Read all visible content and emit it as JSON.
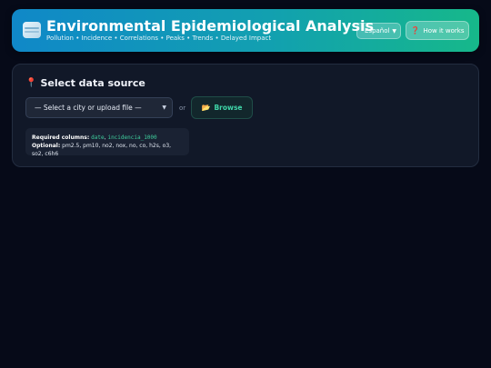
{
  "header": {
    "title": "Environmental Epidemiological Analysis",
    "subtitle": "Pollution • Incidence • Correlations • Peaks • Trends • Delayed Impact",
    "language": "Español",
    "how_it_works": "How it works",
    "logo_icon": "chart-logo-icon"
  },
  "data_source": {
    "title": "Select data source",
    "pin_icon": "pin-icon",
    "select_value": "— Select a city or upload file —",
    "or": "or",
    "browse": "Browse",
    "required_label": "Required columns:",
    "required_col_1": "date",
    "required_sep": ",",
    "required_col_2": "incidencia_1000",
    "optional_label": "Optional:",
    "optional_cols": "pm2.5, pm10, no2, nox, no, co, h2s, o3, so2, c6h6"
  },
  "colors": {
    "accent": "#3fd6a8",
    "header_start": "#1088c8",
    "header_end": "#16b88a",
    "background": "#060a18",
    "card": "#111828"
  }
}
